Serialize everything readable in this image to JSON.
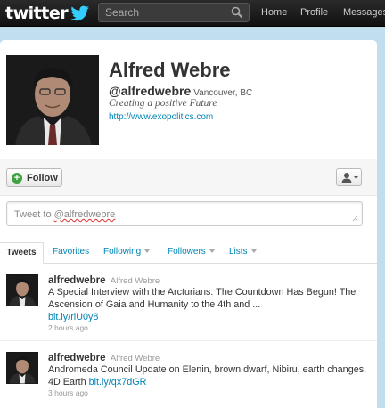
{
  "topbar": {
    "logo_text": "twitter",
    "search_placeholder": "Search",
    "nav": {
      "home": "Home",
      "profile": "Profile",
      "messages": "Messages"
    }
  },
  "profile": {
    "name": "Alfred Webre",
    "handle": "@alfredwebre",
    "location": "Vancouver, BC",
    "bio": "Creating a positive Future",
    "url": "http://www.exopolitics.com",
    "follow_label": "Follow"
  },
  "tweet_box": {
    "prefix": "Tweet to ",
    "handle": "@alfredwebre"
  },
  "tabs": [
    {
      "label": "Tweets"
    },
    {
      "label": "Favorites"
    },
    {
      "label": "Following"
    },
    {
      "label": "Followers"
    },
    {
      "label": "Lists"
    }
  ],
  "tweets": [
    {
      "user": "alfredwebre",
      "fullname": "Alfred Webre",
      "text": "A Special Interview with the Arcturians: The Countdown Has Begun! The Ascension of Gaia and Humanity to the 4th and ...",
      "link": "bit.ly/rlU0y8",
      "time": "2 hours ago"
    },
    {
      "user": "alfredwebre",
      "fullname": "Alfred Webre",
      "text": "Andromeda Council Update on Elenin, brown dwarf, Nibiru, earth changes, 4D Earth ",
      "link": "bit.ly/qx7dGR",
      "time": "3 hours ago"
    }
  ],
  "colors": {
    "background": "#c0deed",
    "link": "#0084b4",
    "topbar": "#1a1a1a",
    "follow_icon": "#3fa240"
  }
}
